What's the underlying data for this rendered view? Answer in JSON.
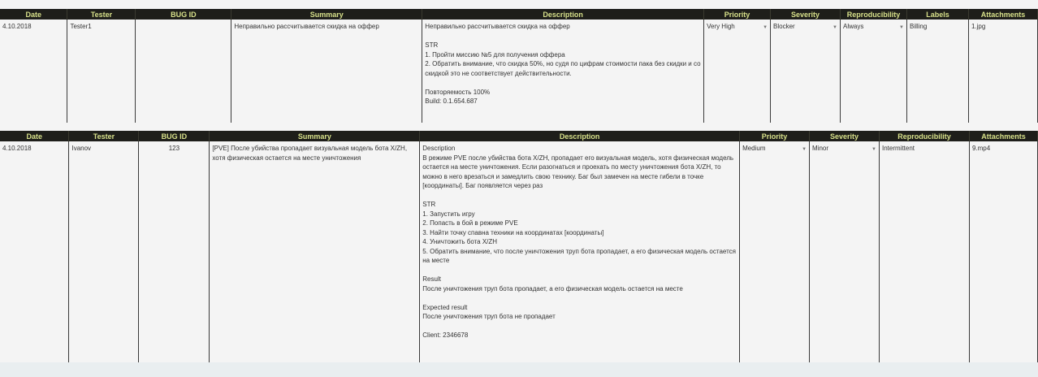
{
  "table1": {
    "headers": [
      "Date",
      "Tester",
      "BUG ID",
      "Summary",
      "Description",
      "Priority",
      "Severity",
      "Reproducibility",
      "Labels",
      "Attachments"
    ],
    "row": {
      "date": "4.10.2018",
      "tester": "Tester1",
      "bug_id": "",
      "summary": "Неправильно рассчитывается скидка на оффер",
      "description": "Неправильно рассчитывается скидка на оффер\n\nSTR\n1. Пройти миссию №5 для получения оффера\n2. Обратить внимание, что скидка 50%, но судя по цифрам стоимости пака без скидки и со скидкой это не соответствует действительности.\n\nПовторяемость 100%\nBuild: 0.1.654.687",
      "priority": "Very High",
      "severity": "Blocker",
      "reproducibility": "Always",
      "labels": "Billing",
      "attachments": "1.jpg"
    }
  },
  "table2": {
    "headers": [
      "Date",
      "Tester",
      "BUG ID",
      "Summary",
      "Description",
      "Priority",
      "Severity",
      "Reproducibility",
      "Attachments"
    ],
    "row": {
      "date": "4.10.2018",
      "tester": "Ivanov",
      "bug_id": "123",
      "summary": "[PVE] После убийства пропадает визуальная модель бота X/ZH, хотя физическая остается на месте уничтожения",
      "description": "Description\nВ режиме PVE после убийства бота X/ZH, пропадает его визуальная модель, хотя физическая модель остается на месте уничтожения. Если разогнаться и проехать по месту уничтожения бота X/ZH, то можно в него врезаться и замедлить свою технику. Баг был замечен на месте гибели в точке [координаты]. Баг появляется через раз\n\nSTR\n1. Запустить игру\n2. Попасть в бой в режиме PVE\n3. Найти точку спавна техники на координатах [координаты]\n4. Уничтожить бота X/ZH\n5. Обратить внимание, что после уничтожения труп бота пропадает, а его физическая модель остается на месте\n\nResult\nПосле уничтожения труп бота пропадает, а его физическая модель остается на месте\n\nExpected result\nПосле уничтожения труп бота не пропадает\n\nClient: 2346678",
      "priority": "Medium",
      "severity": "Minor",
      "reproducibility": "Intermittent",
      "attachments": "9.mp4"
    }
  },
  "colors": {
    "header_bg": "#1e1e1a",
    "header_text": "#d7e08a"
  }
}
